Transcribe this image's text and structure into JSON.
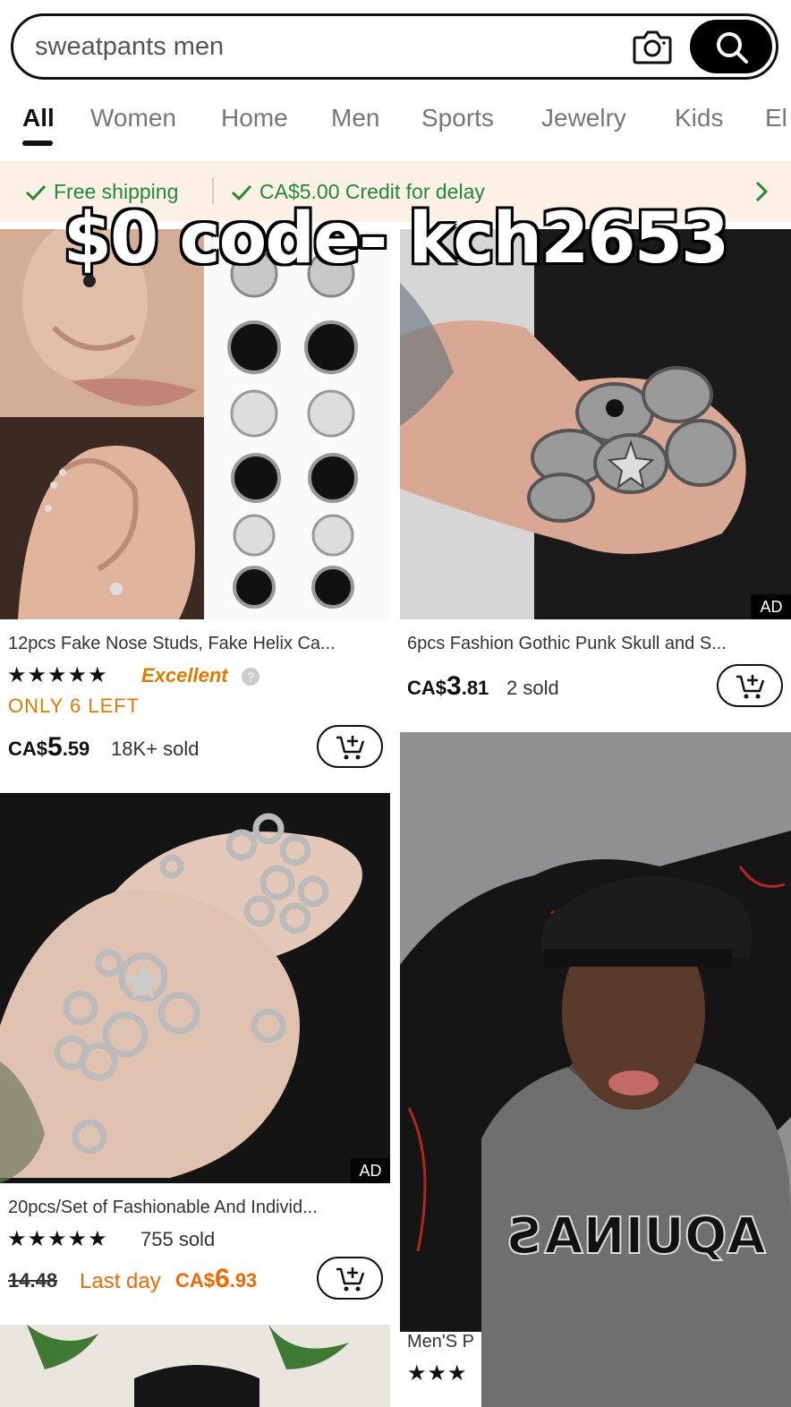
{
  "search": {
    "query": "sweatpants men"
  },
  "tabs": [
    "All",
    "Women",
    "Home",
    "Men",
    "Sports",
    "Jewelry",
    "Kids",
    "El"
  ],
  "promo": {
    "free_shipping": "Free shipping",
    "credit": "CA$5.00 Credit for delay"
  },
  "overlay_caption": "$0 code- kch2653",
  "products": [
    {
      "title": "12pcs Fake Nose Studs, Fake Helix Ca...",
      "stars": "★★★★★",
      "rating_label": "Excellent",
      "stock_note": "ONLY 6 LEFT",
      "currency": "CA$",
      "price_int": "5",
      "price_dec": ".59",
      "sold": "18K+ sold"
    },
    {
      "title": "6pcs Fashion Gothic Punk Skull and S...",
      "currency": "CA$",
      "price_int": "3",
      "price_dec": ".81",
      "sold": "2 sold",
      "ad": "AD"
    },
    {
      "title": "20pcs/Set of Fashionable And Individ...",
      "stars": "★★★★★",
      "sold": "755 sold",
      "original_price": "14.48",
      "deal_label": "Last day",
      "currency": "CA$",
      "price_int": "6",
      "price_dec": ".93",
      "ad": "AD"
    },
    {
      "title": "Men'S P",
      "stars": "★★★"
    }
  ],
  "colors": {
    "promo_green": "#1e8a3a",
    "promo_bg": "#fdf1e5",
    "sale_orange": "#f06a00",
    "rating_orange": "#e07b00"
  }
}
